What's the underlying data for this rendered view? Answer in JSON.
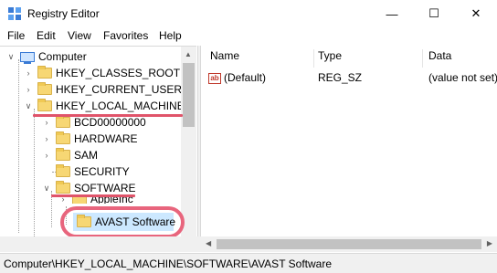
{
  "window": {
    "title": "Registry Editor",
    "controls": {
      "minimize": "—",
      "maximize": "☐",
      "close": "✕"
    }
  },
  "menu": [
    "File",
    "Edit",
    "View",
    "Favorites",
    "Help"
  ],
  "tree": {
    "root": "Computer",
    "nodes": [
      "HKEY_CLASSES_ROOT",
      "HKEY_CURRENT_USER",
      "HKEY_LOCAL_MACHINE",
      "BCD00000000",
      "HARDWARE",
      "SAM",
      "SECURITY",
      "SOFTWARE",
      "AppleInc",
      "AVAST Software"
    ]
  },
  "list": {
    "columns": [
      "Name",
      "Type",
      "Data"
    ],
    "rows": [
      {
        "name": "(Default)",
        "type": "REG_SZ",
        "data": "(value not set)"
      }
    ]
  },
  "status": {
    "path": "Computer\\HKEY_LOCAL_MACHINE\\SOFTWARE\\AVAST Software"
  },
  "colors": {
    "annotation": "#e0546a",
    "selection": "#cce8ff",
    "folder": "#f7d774"
  },
  "icons": {
    "string-value": "ab-icon",
    "folder": "folder-icon",
    "computer": "computer-icon"
  }
}
